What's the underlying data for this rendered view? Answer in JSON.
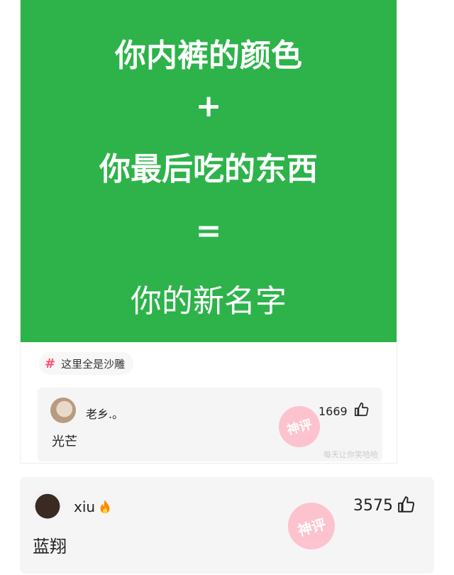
{
  "post": {
    "image_lines": [
      "你内裤的颜色",
      "+",
      "你最后吃的东西",
      "=",
      "你的新名字"
    ],
    "tag": "这里全是沙雕"
  },
  "top_comment": {
    "username": "老乡.。",
    "likes": "1669",
    "text": "光芒",
    "stamp_text": "神评",
    "watermark": "每天让你笑哈哈"
  },
  "second_comment": {
    "username": "xiu",
    "likes": "3575",
    "text": "蓝翔",
    "stamp_text": "神评"
  },
  "icons": [
    "hash-icon",
    "thumb-up-icon",
    "fire-icon",
    "avatar"
  ],
  "colors": {
    "green_bg": "#2db34a",
    "tag_hash": "#ff4d6d",
    "stamp": "#ffb3c1"
  }
}
